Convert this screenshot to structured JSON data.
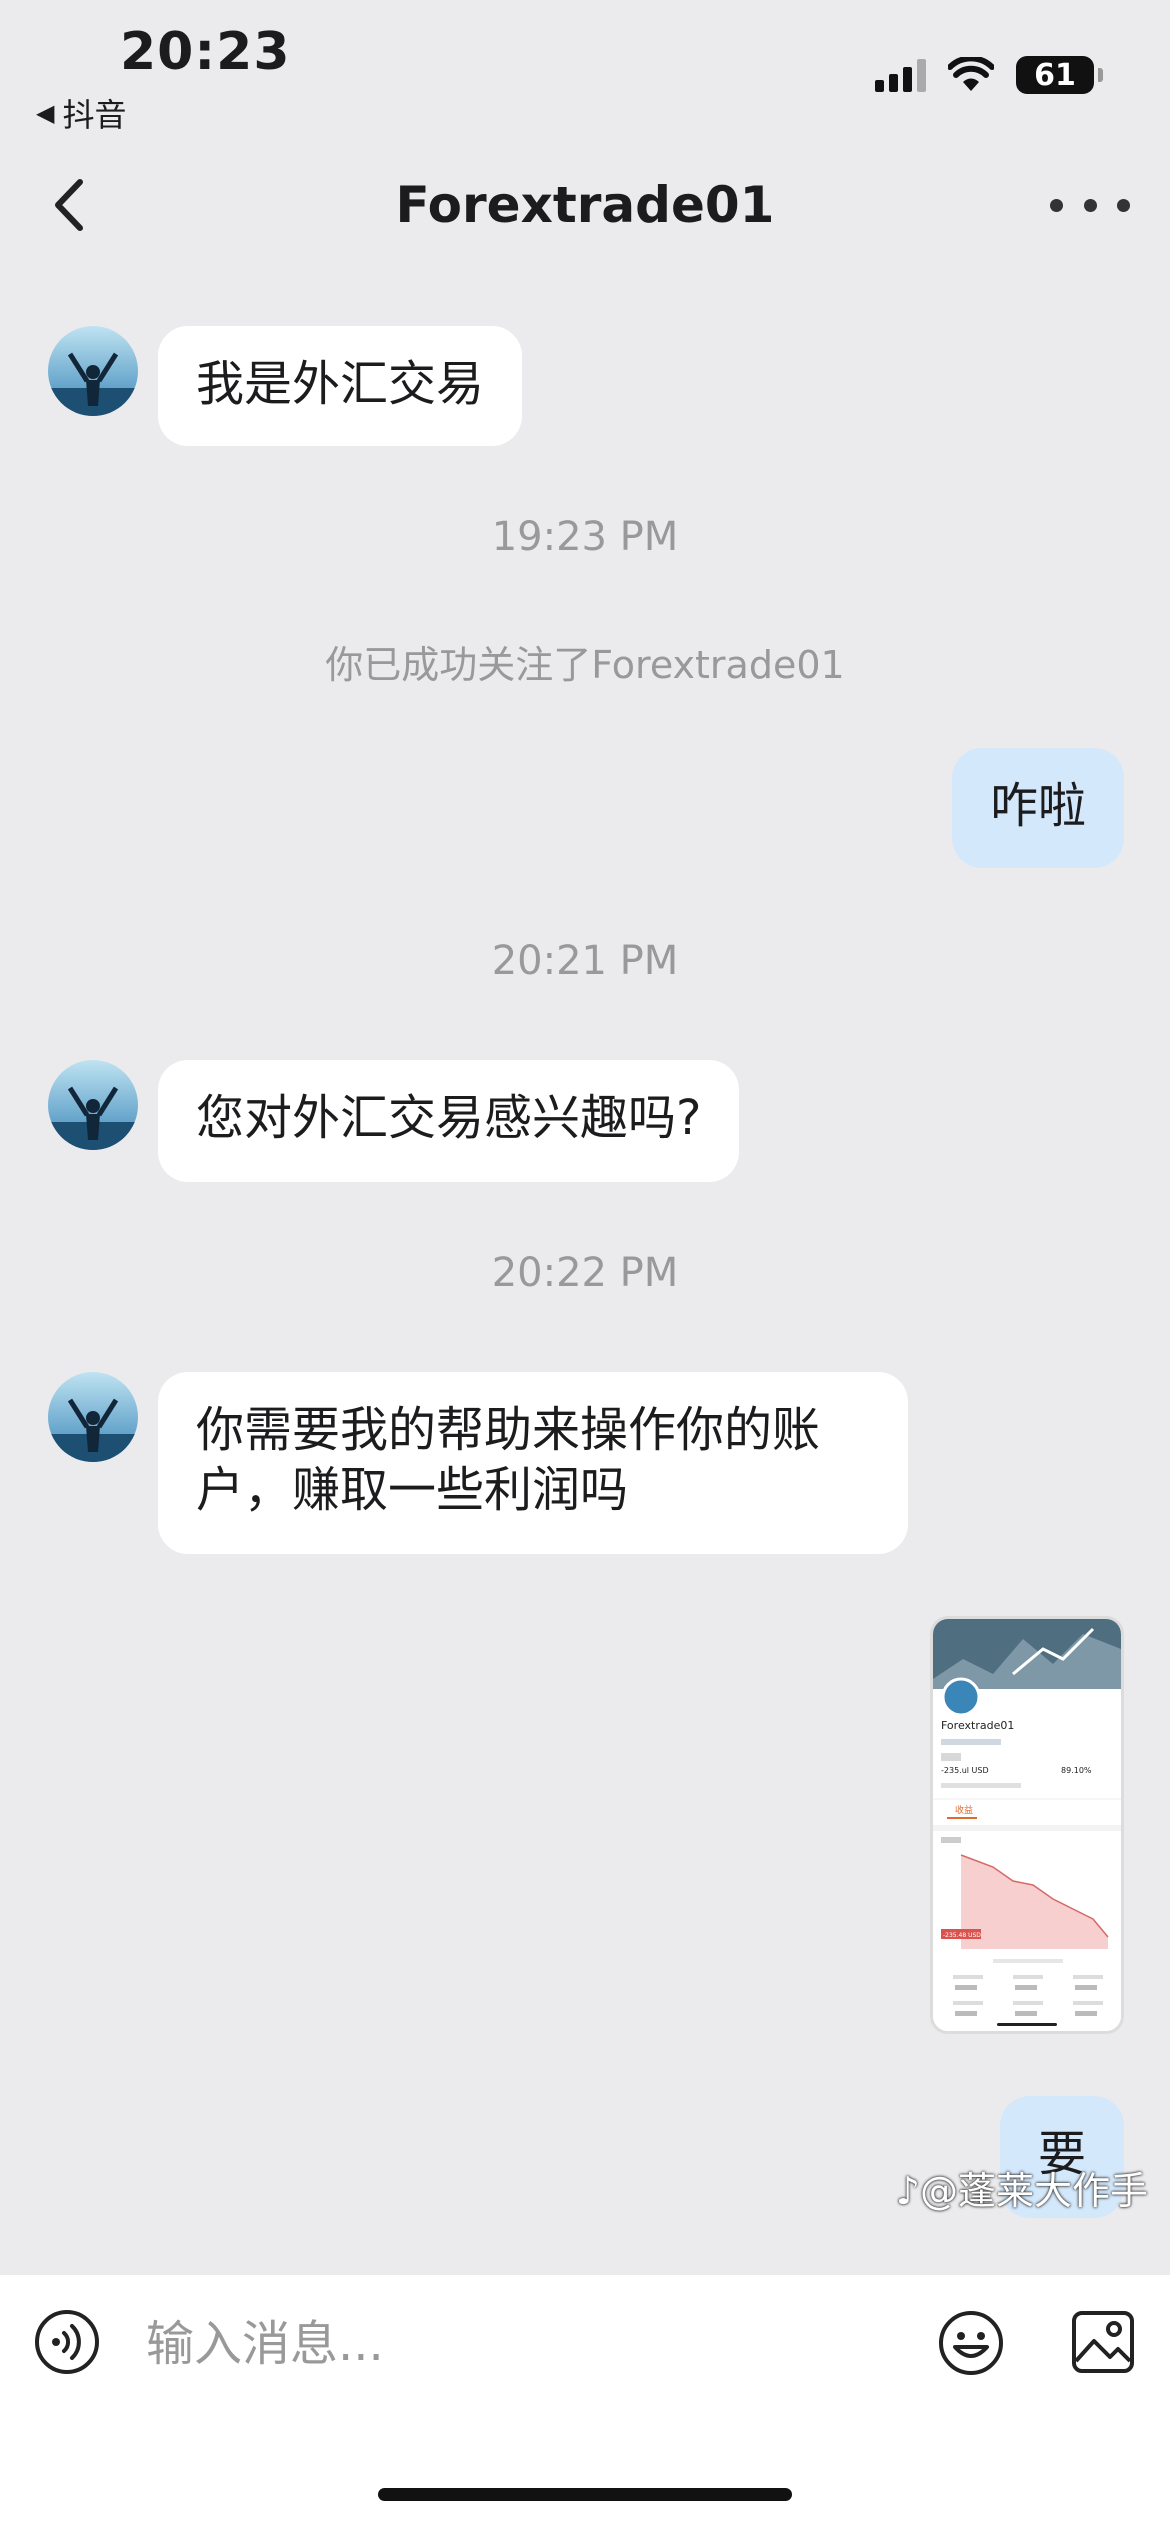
{
  "status_bar": {
    "time": "20:23",
    "back_app": "抖音",
    "battery": "61"
  },
  "header": {
    "title": "Forextrade01"
  },
  "messages": {
    "m1": "我是外汇交易",
    "ts1": "19:23 PM",
    "sys1": "你已成功关注了Forextrade01",
    "m2": "咋啦",
    "ts2": "20:21 PM",
    "m3": "您对外汇交易感兴趣吗?",
    "ts3": "20:22 PM",
    "m4": "你需要我的帮助来操作你的账户，赚取一些利润吗",
    "m5": "要"
  },
  "shared_screenshot": {
    "name": "Forextrade01",
    "pnl": "-235.ul USD",
    "rate": "89.10%",
    "tab": "收益",
    "label": "-235.48 USD"
  },
  "input": {
    "placeholder": "输入消息..."
  },
  "watermark": "♪@蓬莱大作手",
  "colors": {
    "background": "#ebebed",
    "outgoing_bubble": "#d3e8fb",
    "incoming_bubble": "#ffffff"
  }
}
